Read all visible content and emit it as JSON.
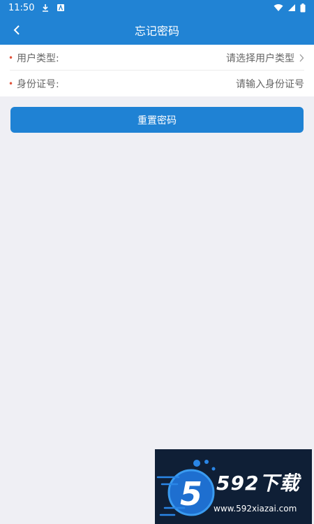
{
  "status": {
    "time": "11:50",
    "icons": [
      "download-icon",
      "a-icon",
      "wifi-icon",
      "signal-icon",
      "battery-icon"
    ]
  },
  "nav": {
    "title": "忘记密码",
    "back_icon": "chevron-left-icon"
  },
  "form": {
    "fields": [
      {
        "label": "用户类型:",
        "value": "请选择用户类型",
        "required": true,
        "has_arrow": true
      },
      {
        "label": "身份证号:",
        "value": "请输入身份证号",
        "required": true,
        "has_arrow": false
      }
    ]
  },
  "actions": {
    "reset_label": "重置密码"
  },
  "colors": {
    "primary": "#2183d4",
    "background": "#efeff4",
    "required": "#e0533b"
  },
  "watermark": {
    "brand": "592下载",
    "url": "www.592xiazai.com"
  }
}
